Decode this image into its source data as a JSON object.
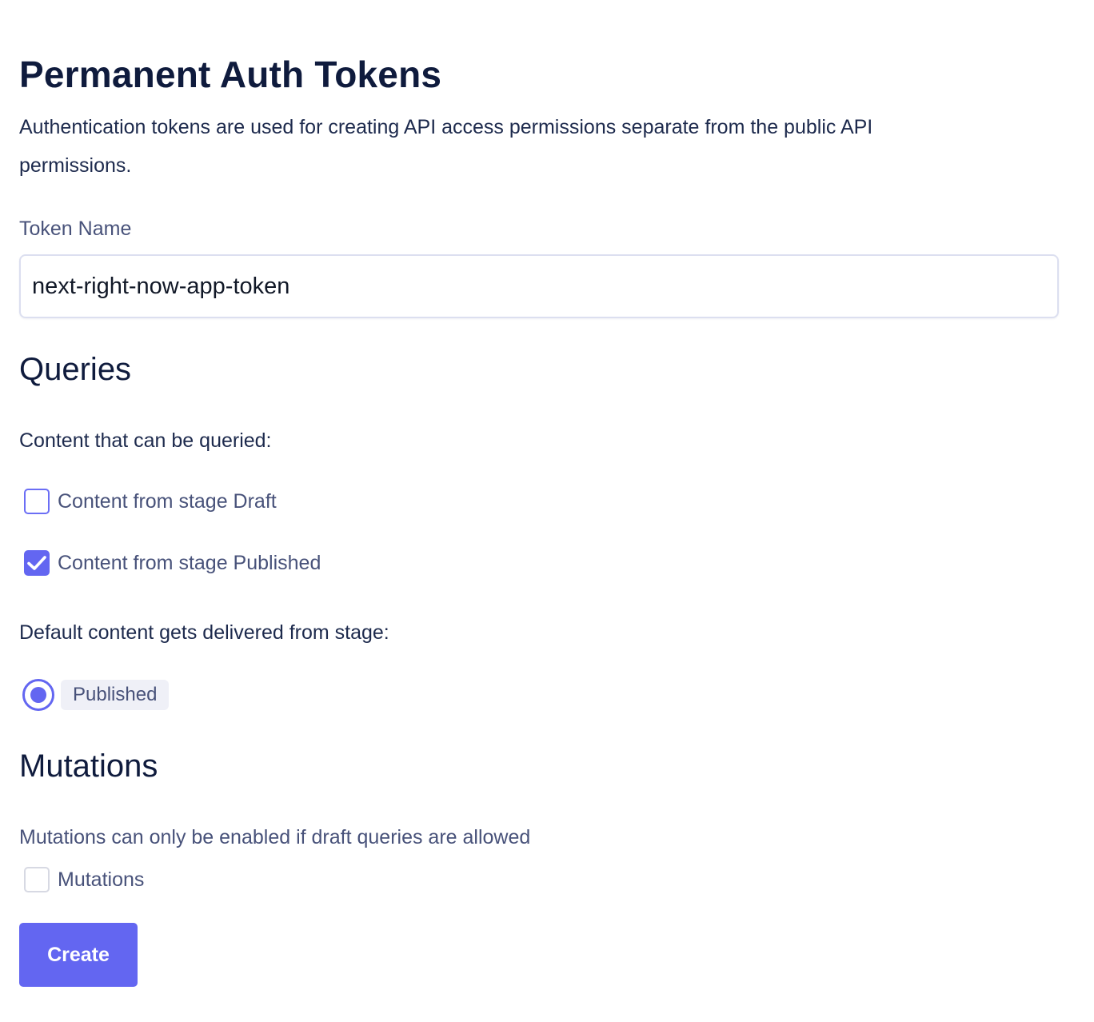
{
  "page": {
    "title": "Permanent Auth Tokens",
    "description": "Authentication tokens are used for creating API access permissions separate from the public API permissions."
  },
  "token_field": {
    "label": "Token Name",
    "value": "next-right-now-app-token"
  },
  "queries": {
    "heading": "Queries",
    "queryable_label": "Content that can be queried:",
    "options": [
      {
        "label": "Content from stage Draft",
        "checked": false
      },
      {
        "label": "Content from stage Published",
        "checked": true
      }
    ],
    "default_stage_label": "Default content gets delivered from stage:",
    "default_stage": {
      "label": "Published",
      "selected": true
    }
  },
  "mutations": {
    "heading": "Mutations",
    "note": "Mutations can only be enabled if draft queries are allowed",
    "checkbox": {
      "label": "Mutations",
      "checked": false,
      "disabled": true
    }
  },
  "actions": {
    "create_label": "Create"
  },
  "colors": {
    "accent": "#6366f1",
    "heading": "#0f1b3d",
    "muted_text": "#48527a",
    "badge_bg": "#eff0f7"
  },
  "icons": {
    "checkmark": "check-icon"
  }
}
